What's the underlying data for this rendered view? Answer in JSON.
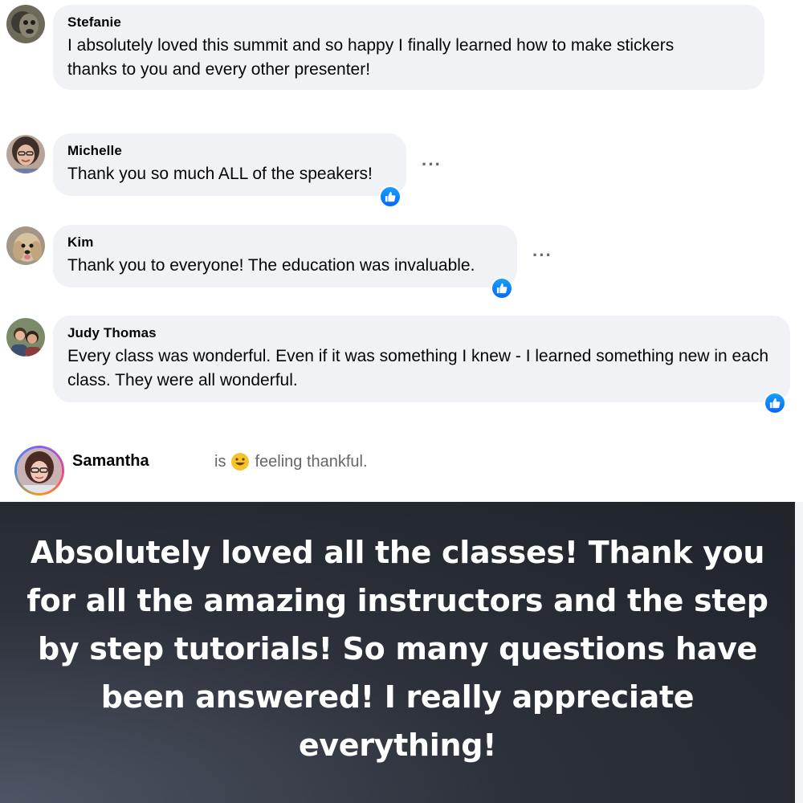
{
  "comments": [
    {
      "name": "Stefanie",
      "text": "I absolutely loved this summit and so happy I finally learned how to make stickers thanks to you and every other presenter!",
      "avatar_icon": "avatar-stefanie",
      "has_like": false,
      "has_more_menu": false
    },
    {
      "name": "Michelle",
      "text": "Thank you so much ALL of the speakers!",
      "avatar_icon": "avatar-michelle",
      "has_like": true,
      "has_more_menu": true
    },
    {
      "name": "Kim",
      "text": "Thank you to everyone! The education was invaluable.",
      "avatar_icon": "avatar-kim",
      "has_like": true,
      "has_more_menu": true
    },
    {
      "name": "Judy Thomas",
      "text": "Every class was wonderful. Even if it was something I knew - I learned something new in each class. They were all wonderful.",
      "avatar_icon": "avatar-judy",
      "has_like": true,
      "has_more_menu": false
    }
  ],
  "more_menu_glyph": "···",
  "status": {
    "name": "Samantha",
    "prefix": "is",
    "feeling": "feeling thankful.",
    "emoji_icon": "smiling-face-icon"
  },
  "quote": {
    "text": "Absolutely loved all the classes! Thank you for all the amazing instructors and the step by step tutorials! So many questions have been answered! I really appreciate everything!"
  },
  "colors": {
    "bubble": "#f0f2f5",
    "like_blue": "#0866ff",
    "muted_text": "#65676b",
    "quote_bg": "#2c313b"
  }
}
